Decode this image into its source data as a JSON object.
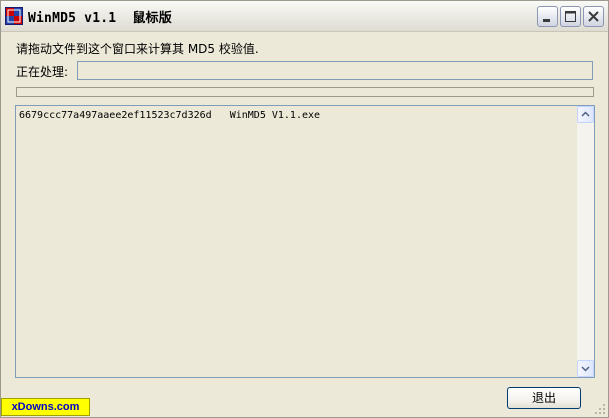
{
  "window": {
    "title": "WinMD5 v1.1  鼠标版",
    "icon": "winmd5-app-icon"
  },
  "titlebar_buttons": {
    "minimize_icon": "minimize-icon",
    "maximize_icon": "maximize-icon",
    "close_icon": "close-icon"
  },
  "main": {
    "prompt": "请拖动文件到这个窗口来计算其 MD5 校验值.",
    "processing_label": "正在处理:",
    "processing_value": "",
    "progress": 0
  },
  "results": {
    "rows": [
      {
        "hash": "6679ccc77a497aaee2ef11523c7d326d",
        "file": "WinMD5 V1.1.exe"
      }
    ]
  },
  "actions": {
    "exit_label": "退出"
  },
  "watermark": {
    "text": "xDowns.com"
  },
  "colors": {
    "window_bg": "#ece9d8",
    "border_blue": "#7f9db9",
    "watermark_bg": "#ffff00",
    "watermark_text": "#0000cc"
  }
}
